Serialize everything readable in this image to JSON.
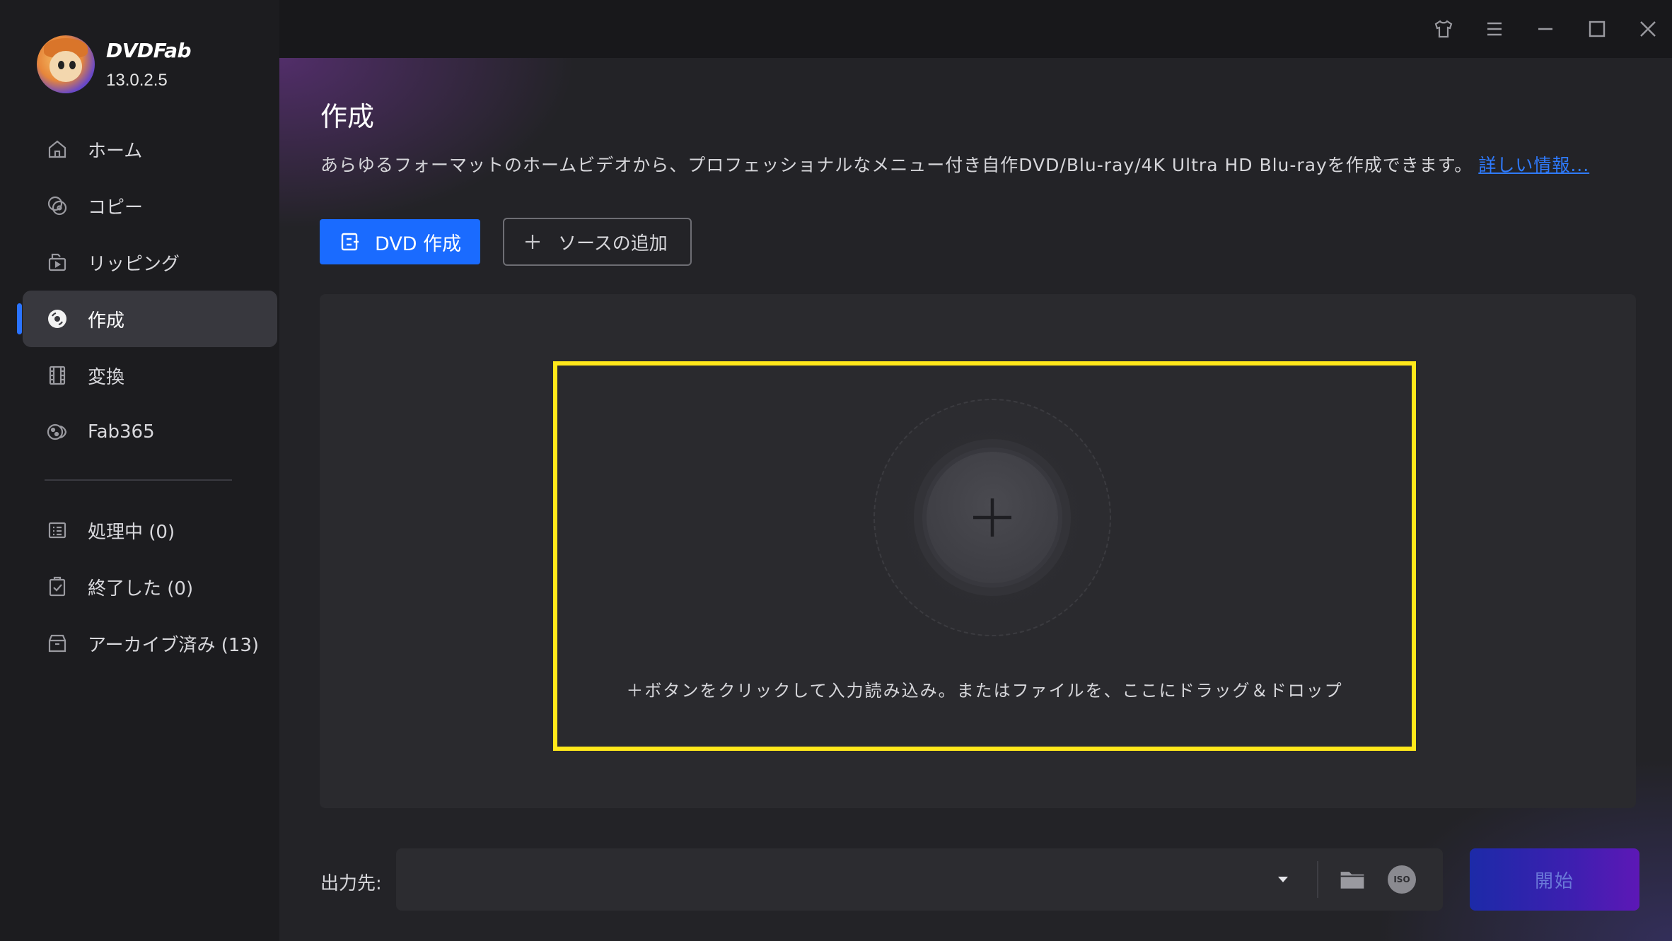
{
  "app": {
    "brand_name": "DVDFab",
    "version": "13.0.2.5"
  },
  "sidebar": {
    "items": [
      {
        "label": "ホーム",
        "icon": "home-icon"
      },
      {
        "label": "コピー",
        "icon": "copy-icon"
      },
      {
        "label": "リッピング",
        "icon": "ripper-icon"
      },
      {
        "label": "作成",
        "icon": "creator-disc-icon",
        "active": true
      },
      {
        "label": "変換",
        "icon": "film-icon"
      },
      {
        "label": "Fab365",
        "icon": "fab365-icon"
      }
    ],
    "task_items": [
      {
        "label": "処理中 (0)",
        "icon": "task-list-icon"
      },
      {
        "label": "終了した (0)",
        "icon": "clipboard-check-icon"
      },
      {
        "label": "アーカイブ済み (13)",
        "icon": "archive-icon"
      }
    ]
  },
  "titlebar": {
    "icons": [
      "skin-icon",
      "menu-icon",
      "minimize-icon",
      "maximize-icon",
      "close-icon"
    ]
  },
  "main": {
    "title": "作成",
    "description": "あらゆるフォーマットのホームビデオから、プロフェッショナルなメニュー付き自作DVD/Blu-ray/4K Ultra HD Blu-rayを作成できます。",
    "more_info_link": "詳しい情報...",
    "dvd_create_button": "DVD 作成",
    "add_source_button": "ソースの追加",
    "drop_hint": "＋ボタンをクリックして入力読み込み。またはファイルを、ここにドラッグ＆ドロップ"
  },
  "output": {
    "label": "出力先:",
    "value": "",
    "iso_label": "ISO",
    "start_button": "開始"
  },
  "colors": {
    "accent_blue": "#1a6bff",
    "highlight_yellow": "#ffe81a",
    "start_gradient_from": "#1c2aa8",
    "start_gradient_to": "#5d18b6"
  }
}
